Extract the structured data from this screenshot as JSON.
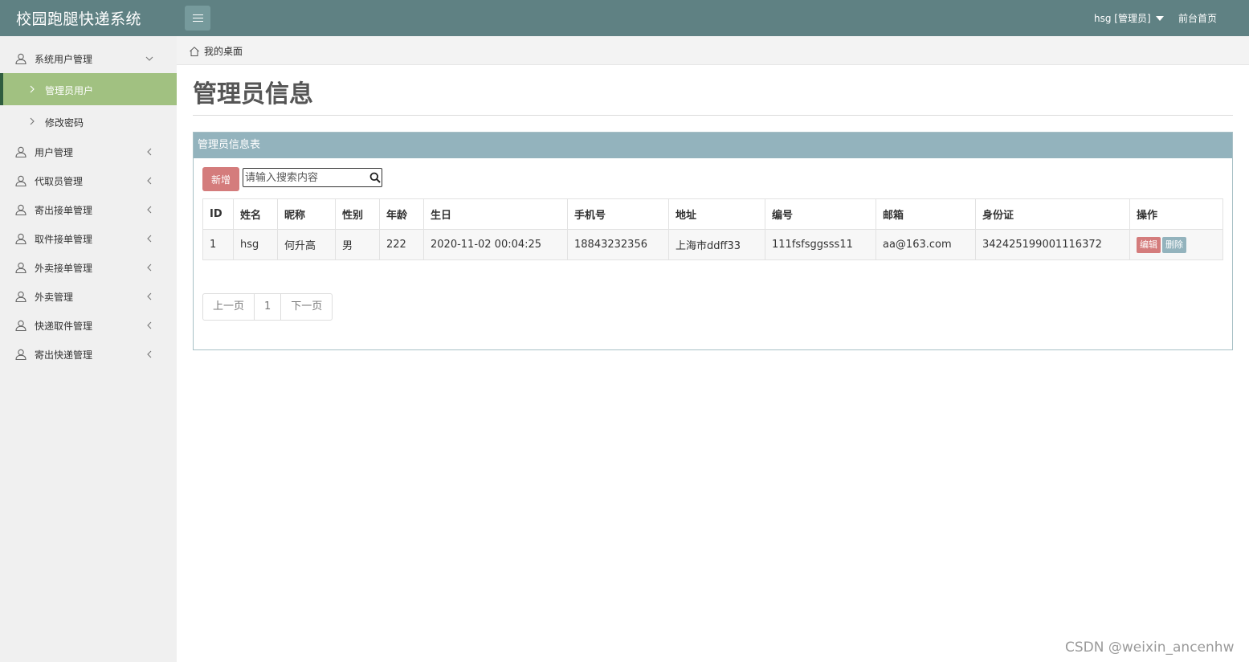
{
  "header": {
    "brand": "校园跑腿快递系统",
    "user_label": "hsg [管理员]",
    "front_link": "前台首页"
  },
  "sidebar": {
    "items": [
      {
        "label": "系统用户管理",
        "expanded": true
      },
      {
        "label": "用户管理"
      },
      {
        "label": "代取员管理"
      },
      {
        "label": "寄出接单管理"
      },
      {
        "label": "取件接单管理"
      },
      {
        "label": "外卖接单管理"
      },
      {
        "label": "外卖管理"
      },
      {
        "label": "快递取件管理"
      },
      {
        "label": "寄出快递管理"
      }
    ],
    "subitems": [
      {
        "label": "管理员用户",
        "active": true
      },
      {
        "label": "修改密码"
      }
    ]
  },
  "breadcrumb": {
    "label": "我的桌面"
  },
  "page": {
    "title": "管理员信息"
  },
  "panel": {
    "title": "管理员信息表",
    "add_label": "新增",
    "search_placeholder": "请输入搜索内容"
  },
  "table": {
    "columns": [
      "ID",
      "姓名",
      "昵称",
      "性别",
      "年龄",
      "生日",
      "手机号",
      "地址",
      "编号",
      "邮箱",
      "身份证",
      "操作"
    ],
    "rows": [
      {
        "id": "1",
        "name": "hsg",
        "nickname": "何升高",
        "gender": "男",
        "age": "222",
        "birthday": "2020-11-02 00:04:25",
        "phone": "18843232356",
        "address": "上海市ddff33",
        "number": "111fsfsggsss11",
        "email": "aa@163.com",
        "idcard": "342425199001116372",
        "edit_label": "编辑",
        "delete_label": "删除"
      }
    ]
  },
  "pagination": {
    "prev": "上一页",
    "current": "1",
    "next": "下一页"
  },
  "watermark": "CSDN @weixin_ancenhw",
  "colors": {
    "header": "#5f8183",
    "sidebar_active": "#a1c181",
    "panel_head": "#93b3bd",
    "add_button": "#d47c7c"
  }
}
